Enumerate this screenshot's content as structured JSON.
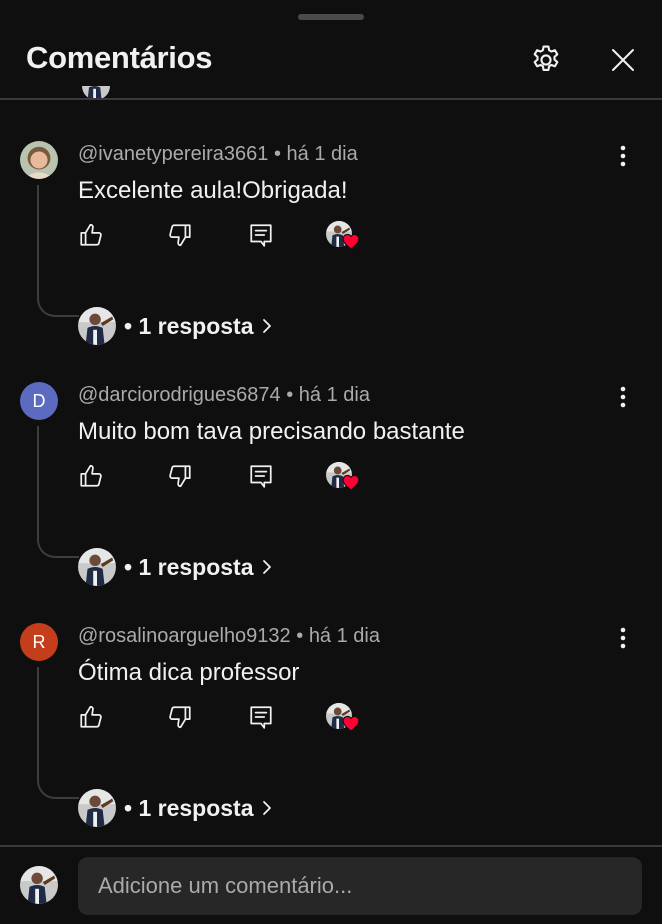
{
  "header": {
    "title": "Comentários",
    "settings_icon": "gear-icon",
    "close_icon": "close-icon"
  },
  "colors": {
    "background": "#0f0f0f",
    "text_primary": "#f1f1f1",
    "text_secondary": "#aaaaaa",
    "input_bg": "#272727",
    "divider": "#3a3a3a",
    "heart": "#ff0033",
    "avatar_d": "#5c6bc0",
    "avatar_r": "#c43e1c"
  },
  "comments": [
    {
      "author": "@ivanetypereira3661",
      "time": "há 1 dia",
      "text": "Excelente aula!Obrigada!",
      "avatar_type": "photo",
      "avatar_letter": "",
      "replies_label": "• 1 resposta"
    },
    {
      "author": "@darciorodrigues6874",
      "time": "há 1 dia",
      "text": "Muito bom tava precisando bastante",
      "avatar_type": "letter",
      "avatar_letter": "D",
      "replies_label": "• 1 resposta"
    },
    {
      "author": "@rosalinoarguelho9132",
      "time": "há 1 dia",
      "text": "Ótima dica professor",
      "avatar_type": "letter",
      "avatar_letter": "R",
      "replies_label": "• 1 resposta"
    }
  ],
  "composer": {
    "placeholder": "Adicione um comentário..."
  }
}
